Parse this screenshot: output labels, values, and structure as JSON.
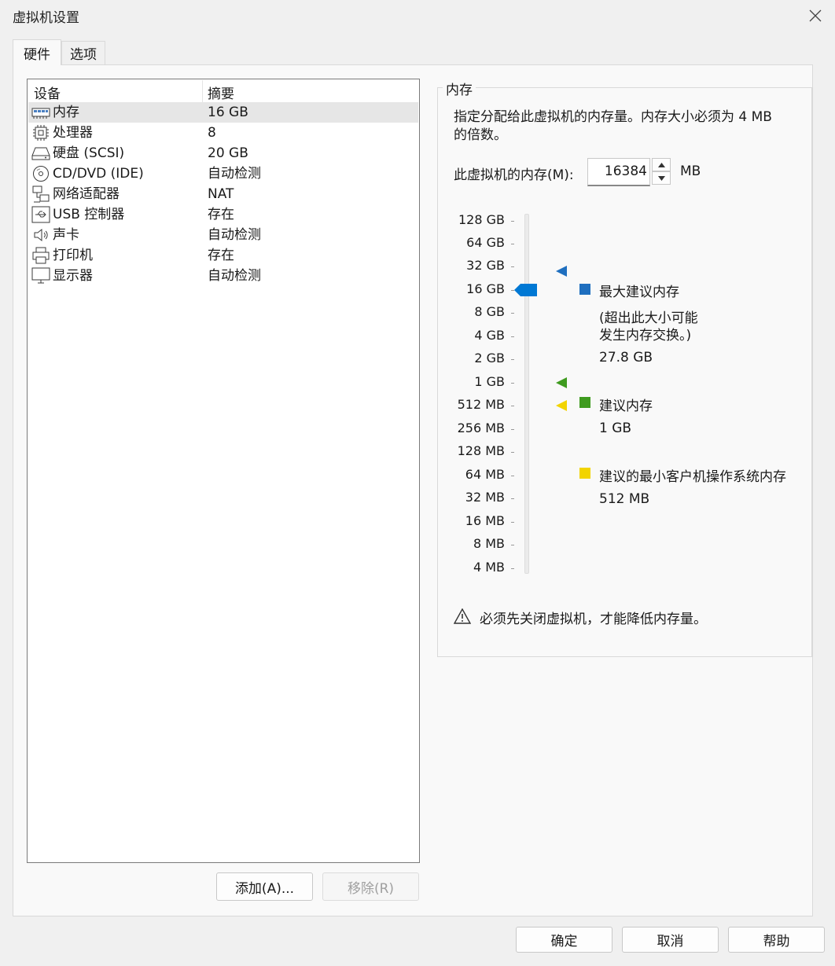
{
  "window": {
    "title": "虚拟机设置",
    "close_icon": "close-icon"
  },
  "tabs": [
    {
      "label": "硬件",
      "active": true
    },
    {
      "label": "选项",
      "active": false
    }
  ],
  "device_list": {
    "columns": [
      "设备",
      "摘要"
    ],
    "rows": [
      {
        "icon": "memory-icon",
        "name": "内存",
        "summary": "16 GB",
        "selected": true
      },
      {
        "icon": "processor-icon",
        "name": "处理器",
        "summary": "8"
      },
      {
        "icon": "hard-disk-icon",
        "name": "硬盘 (SCSI)",
        "summary": "20 GB"
      },
      {
        "icon": "cd-dvd-icon",
        "name": "CD/DVD (IDE)",
        "summary": "自动检测"
      },
      {
        "icon": "network-adapter-icon",
        "name": "网络适配器",
        "summary": "NAT"
      },
      {
        "icon": "usb-icon",
        "name": "USB 控制器",
        "summary": "存在"
      },
      {
        "icon": "sound-card-icon",
        "name": "声卡",
        "summary": "自动检测"
      },
      {
        "icon": "printer-icon",
        "name": "打印机",
        "summary": "存在"
      },
      {
        "icon": "display-icon",
        "name": "显示器",
        "summary": "自动检测"
      }
    ],
    "add_button": "添加(A)...",
    "remove_button": "移除(R)"
  },
  "memory": {
    "group_title": "内存",
    "description_line1": "指定分配给此虚拟机的内存量。内存大小必须为 4 MB",
    "description_line2": "的倍数。",
    "input_label": "此虚拟机的内存(M):",
    "value": "16384",
    "unit": "MB",
    "scale_labels": [
      "128 GB",
      "64 GB",
      "32 GB",
      "16 GB",
      "8 GB",
      "4 GB",
      "2 GB",
      "1 GB",
      "512 MB",
      "256 MB",
      "128 MB",
      "64 MB",
      "32 MB",
      "16 MB",
      "8 MB",
      "4 MB"
    ],
    "slider_value": "16 GB",
    "max_recommended": {
      "label": "最大建议内存",
      "note_line1": "(超出此大小可能",
      "note_line2": "发生内存交换。)",
      "value": "27.8 GB",
      "color": "#1f6fbf"
    },
    "recommended": {
      "label": "建议内存",
      "value": "1 GB",
      "color": "#3f9b1f"
    },
    "min_recommended": {
      "label": "建议的最小客户机操作系统内存",
      "value": "512 MB",
      "color": "#f2d400"
    },
    "warning": "必须先关闭虚拟机，才能降低内存量。"
  },
  "footer": {
    "ok": "确定",
    "cancel": "取消",
    "help": "帮助"
  },
  "colors": {
    "accent": "#0078d4"
  }
}
